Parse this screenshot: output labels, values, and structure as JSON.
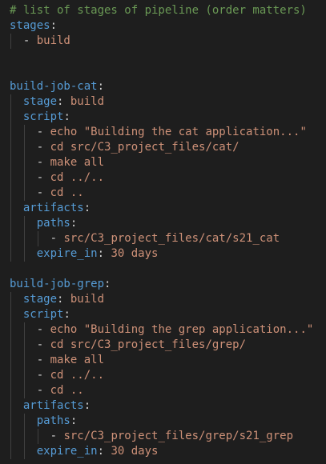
{
  "editor": {
    "language": "yaml",
    "colors": {
      "background": "#1e1e1e",
      "comment": "#6a9955",
      "key": "#569cd6",
      "string": "#ce9178",
      "punctuation": "#d4d4d4",
      "indent_guide": "#404040"
    },
    "lines": [
      {
        "indent": 0,
        "tokens": [
          {
            "t": "comment",
            "v": "# list of stages of pipeline (order matters)"
          }
        ]
      },
      {
        "indent": 0,
        "tokens": [
          {
            "t": "key",
            "v": "stages"
          },
          {
            "t": "punc",
            "v": ":"
          }
        ]
      },
      {
        "indent": 1,
        "tokens": [
          {
            "t": "punc",
            "v": "- "
          },
          {
            "t": "str",
            "v": "build"
          }
        ]
      },
      {
        "indent": 0,
        "tokens": []
      },
      {
        "indent": 0,
        "tokens": []
      },
      {
        "indent": 0,
        "tokens": [
          {
            "t": "key",
            "v": "build-job-cat"
          },
          {
            "t": "punc",
            "v": ":"
          }
        ]
      },
      {
        "indent": 1,
        "tokens": [
          {
            "t": "key",
            "v": "stage"
          },
          {
            "t": "punc",
            "v": ": "
          },
          {
            "t": "str",
            "v": "build"
          }
        ]
      },
      {
        "indent": 1,
        "tokens": [
          {
            "t": "key",
            "v": "script"
          },
          {
            "t": "punc",
            "v": ":"
          }
        ]
      },
      {
        "indent": 2,
        "tokens": [
          {
            "t": "punc",
            "v": "- "
          },
          {
            "t": "str",
            "v": "echo \"Building the cat application...\""
          }
        ]
      },
      {
        "indent": 2,
        "tokens": [
          {
            "t": "punc",
            "v": "- "
          },
          {
            "t": "str",
            "v": "cd src/C3_project_files/cat/"
          }
        ]
      },
      {
        "indent": 2,
        "tokens": [
          {
            "t": "punc",
            "v": "- "
          },
          {
            "t": "str",
            "v": "make all"
          }
        ]
      },
      {
        "indent": 2,
        "tokens": [
          {
            "t": "punc",
            "v": "- "
          },
          {
            "t": "str",
            "v": "cd ../.."
          }
        ]
      },
      {
        "indent": 2,
        "tokens": [
          {
            "t": "punc",
            "v": "- "
          },
          {
            "t": "str",
            "v": "cd .."
          }
        ]
      },
      {
        "indent": 1,
        "tokens": [
          {
            "t": "key",
            "v": "artifacts"
          },
          {
            "t": "punc",
            "v": ":"
          }
        ]
      },
      {
        "indent": 2,
        "tokens": [
          {
            "t": "key",
            "v": "paths"
          },
          {
            "t": "punc",
            "v": ":"
          }
        ]
      },
      {
        "indent": 3,
        "tokens": [
          {
            "t": "punc",
            "v": "- "
          },
          {
            "t": "str",
            "v": "src/C3_project_files/cat/s21_cat"
          }
        ]
      },
      {
        "indent": 2,
        "tokens": [
          {
            "t": "key",
            "v": "expire_in"
          },
          {
            "t": "punc",
            "v": ": "
          },
          {
            "t": "str",
            "v": "30 days"
          }
        ]
      },
      {
        "indent": 0,
        "tokens": []
      },
      {
        "indent": 0,
        "tokens": [
          {
            "t": "key",
            "v": "build-job-grep"
          },
          {
            "t": "punc",
            "v": ":"
          }
        ]
      },
      {
        "indent": 1,
        "tokens": [
          {
            "t": "key",
            "v": "stage"
          },
          {
            "t": "punc",
            "v": ": "
          },
          {
            "t": "str",
            "v": "build"
          }
        ]
      },
      {
        "indent": 1,
        "tokens": [
          {
            "t": "key",
            "v": "script"
          },
          {
            "t": "punc",
            "v": ":"
          }
        ]
      },
      {
        "indent": 2,
        "tokens": [
          {
            "t": "punc",
            "v": "- "
          },
          {
            "t": "str",
            "v": "echo \"Building the grep application...\""
          }
        ]
      },
      {
        "indent": 2,
        "tokens": [
          {
            "t": "punc",
            "v": "- "
          },
          {
            "t": "str",
            "v": "cd src/C3_project_files/grep/"
          }
        ]
      },
      {
        "indent": 2,
        "tokens": [
          {
            "t": "punc",
            "v": "- "
          },
          {
            "t": "str",
            "v": "make all"
          }
        ]
      },
      {
        "indent": 2,
        "tokens": [
          {
            "t": "punc",
            "v": "- "
          },
          {
            "t": "str",
            "v": "cd ../.."
          }
        ]
      },
      {
        "indent": 2,
        "tokens": [
          {
            "t": "punc",
            "v": "- "
          },
          {
            "t": "str",
            "v": "cd .."
          }
        ]
      },
      {
        "indent": 1,
        "tokens": [
          {
            "t": "key",
            "v": "artifacts"
          },
          {
            "t": "punc",
            "v": ":"
          }
        ]
      },
      {
        "indent": 2,
        "tokens": [
          {
            "t": "key",
            "v": "paths"
          },
          {
            "t": "punc",
            "v": ":"
          }
        ]
      },
      {
        "indent": 3,
        "tokens": [
          {
            "t": "punc",
            "v": "- "
          },
          {
            "t": "str",
            "v": "src/C3_project_files/grep/s21_grep"
          }
        ]
      },
      {
        "indent": 2,
        "tokens": [
          {
            "t": "key",
            "v": "expire_in"
          },
          {
            "t": "punc",
            "v": ": "
          },
          {
            "t": "str",
            "v": "30 days"
          }
        ]
      }
    ]
  }
}
